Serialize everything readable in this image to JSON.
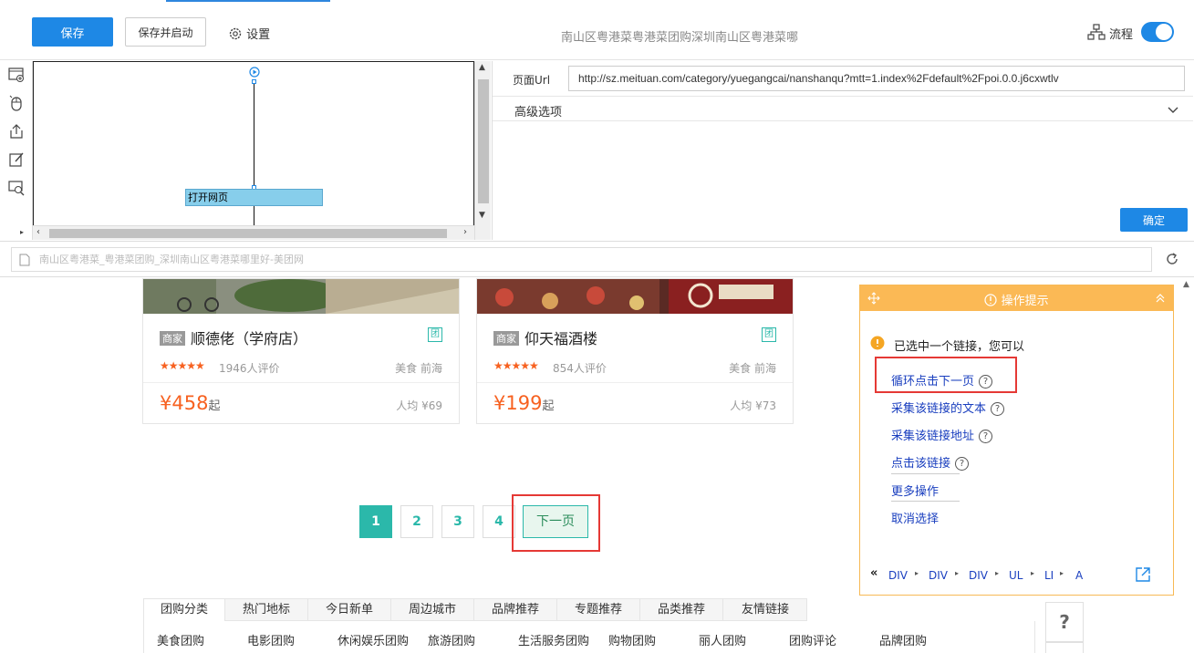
{
  "toolbar": {
    "save_label": "保存",
    "save_start_label": "保存并启动",
    "settings_label": "设置",
    "page_title": "南山区粤港菜粤港菜团购深圳南山区粤港菜哪",
    "flow_label": "流程",
    "accent": "#1e88e5"
  },
  "flow": {
    "node_label": "打开网页"
  },
  "panel": {
    "url_label": "页面Url",
    "url_value": "http://sz.meituan.com/category/yuegangcai/nanshanqu?mtt=1.index%2Fdefault%2Fpoi.0.0.j6cxwtlv",
    "advanced_label": "高级选项",
    "confirm_label": "确定"
  },
  "address": {
    "title": "南山区粤港菜_粤港菜团购_深圳南山区粤港菜哪里好-美团网"
  },
  "cards": [
    {
      "tag": "商家",
      "name": "顺德佬（学府店）",
      "tuan": "团",
      "stars": "★★★★★",
      "reviews": "1946人评价",
      "area": "美食 前海",
      "price": "¥458",
      "price_suffix": "起",
      "avg": "人均 ¥69"
    },
    {
      "tag": "商家",
      "name": "仰天福酒楼",
      "tuan": "团",
      "stars": "★★★★★",
      "reviews": "854人评价",
      "area": "美食 前海",
      "price": "¥199",
      "price_suffix": "起",
      "avg": "人均 ¥73"
    }
  ],
  "pagination": {
    "pages": [
      "1",
      "2",
      "3",
      "4"
    ],
    "current": "1",
    "next_label": "下一页"
  },
  "tips": {
    "title": "操作提示",
    "intro": "已选中一个链接，您可以",
    "actions": [
      "循环点击下一页",
      "采集该链接的文本",
      "采集该链接地址",
      "点击该链接",
      "更多操作",
      "取消选择"
    ],
    "breadcrumb": [
      "DIV",
      "DIV",
      "DIV",
      "UL",
      "LI",
      "A"
    ],
    "header_color": "#fbb955"
  },
  "footer_tabs": [
    "团购分类",
    "热门地标",
    "今日新单",
    "周边城市",
    "品牌推荐",
    "专题推荐",
    "品类推荐",
    "友情链接"
  ],
  "footer_links": [
    "美食团购",
    "电影团购",
    "休闲娱乐团购",
    "旅游团购",
    "生活服务团购",
    "购物团购",
    "丽人团购",
    "团购评论",
    "品牌团购"
  ],
  "side_buttons": [
    "?"
  ]
}
